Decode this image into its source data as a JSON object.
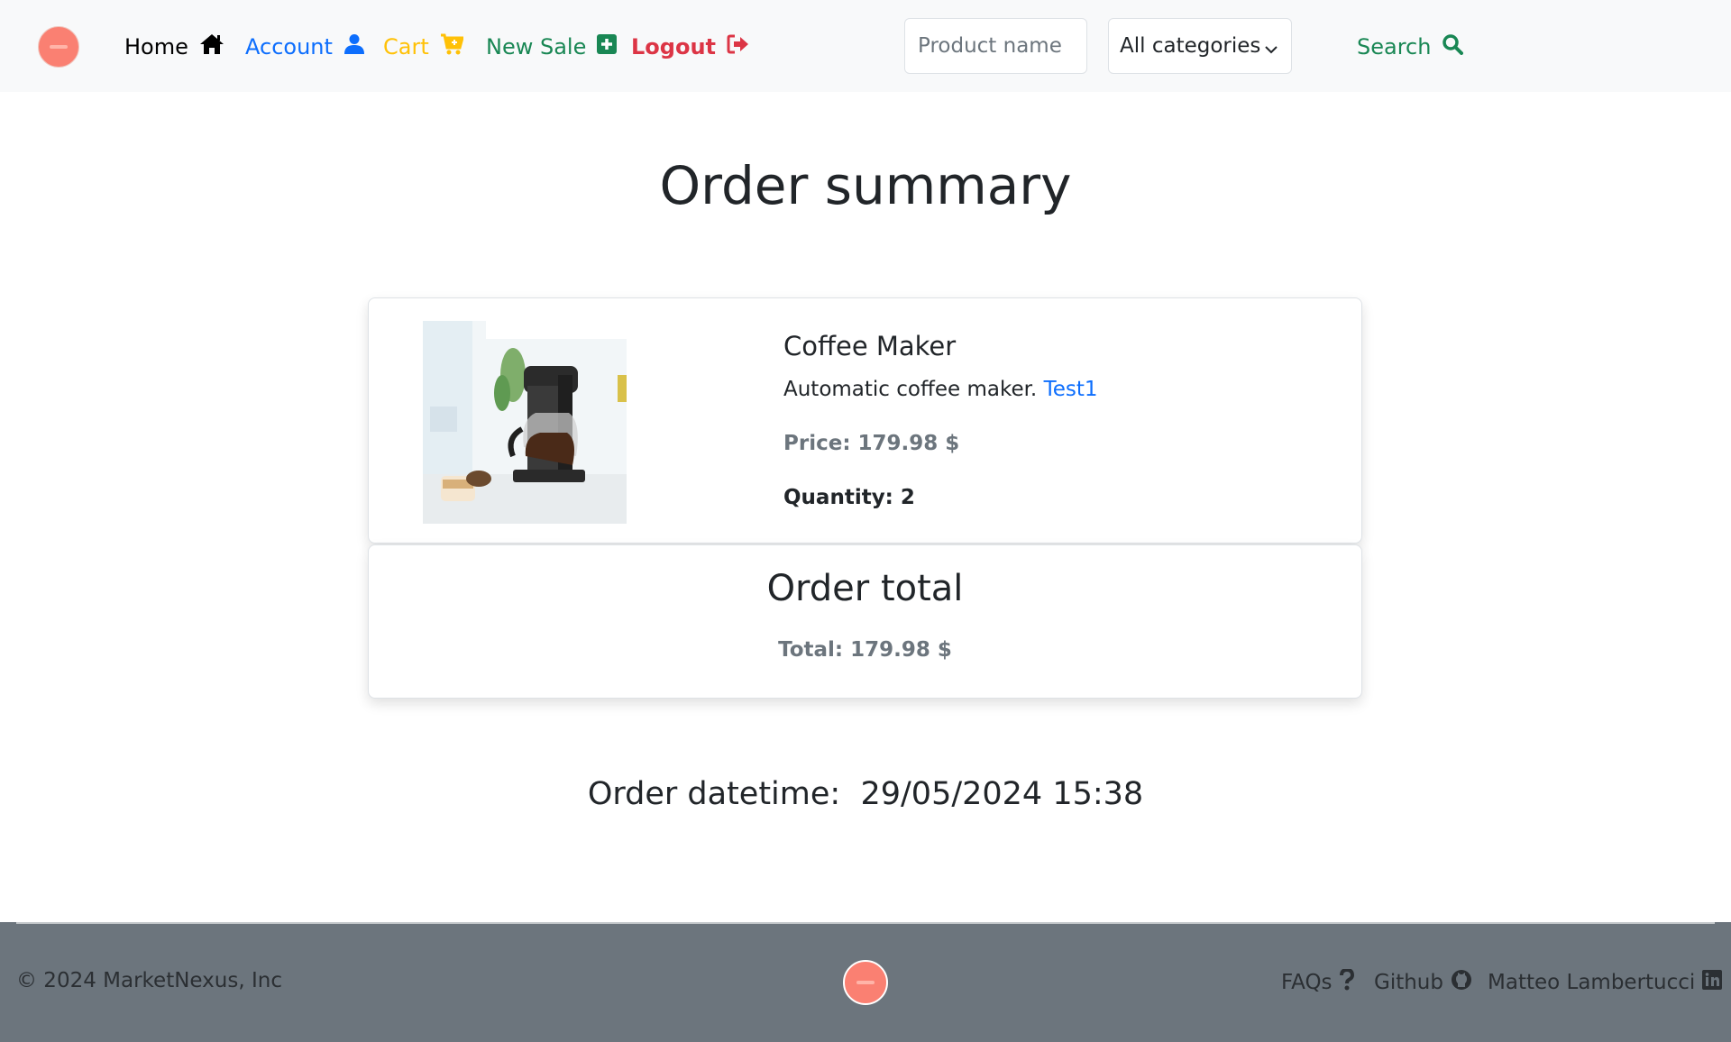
{
  "nav": {
    "home_label": "Home",
    "account_label": "Account",
    "cart_label": "Cart",
    "new_sale_label": "New Sale",
    "logout_label": "Logout",
    "search_placeholder": "Product name",
    "category_selected": "All categories",
    "search_label": "Search",
    "icons": [
      "home-icon",
      "user-icon",
      "cart-plus-icon",
      "plus-square-icon",
      "logout-icon",
      "chevron-down-icon",
      "search-icon"
    ]
  },
  "page": {
    "title": "Order summary"
  },
  "order": {
    "items": [
      {
        "name": "Coffee Maker",
        "description": "Automatic coffee maker.",
        "seller": "Test1",
        "price": "Price: 179.98 $",
        "quantity": "Quantity: 2"
      }
    ],
    "total_title": "Order total",
    "total_value": "Total: 179.98 $",
    "datetime_label": "Order datetime:",
    "datetime_value": "29/05/2024 15:38"
  },
  "footer": {
    "copyright": "© 2024 MarketNexus, Inc",
    "faqs_label": "FAQs",
    "github_label": "Github",
    "author_label": "Matteo Lambertucci",
    "icons": [
      "question-icon",
      "github-icon",
      "linkedin-icon"
    ]
  },
  "colors": {
    "brand": "#fa8072",
    "primary": "#0d6efd",
    "warning": "#ffc107",
    "success": "#198754",
    "danger": "#dc3545",
    "muted": "#6c757d"
  }
}
